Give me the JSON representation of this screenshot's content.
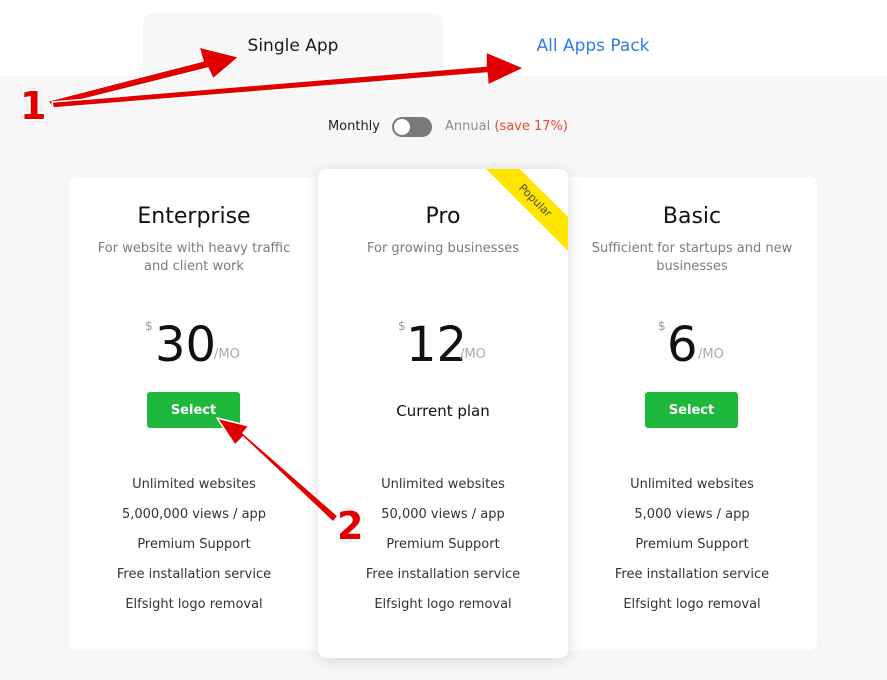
{
  "tabs": [
    {
      "label": "Single App",
      "active": true
    },
    {
      "label": "All Apps Pack",
      "active": false
    }
  ],
  "billing": {
    "monthly_label": "Monthly",
    "annual_label": "Annual",
    "save_label": "(save 17%)",
    "toggle_on": false
  },
  "plans": [
    {
      "name": "Enterprise",
      "description": "For website with heavy traffic and client work",
      "currency": "$",
      "price": "30",
      "period": "/MO",
      "action_label": "Select",
      "features": [
        "Unlimited websites",
        "5,000,000 views / app",
        "Premium Support",
        "Free installation service",
        "Elfsight logo removal"
      ]
    },
    {
      "name": "Pro",
      "description": "For growing businesses",
      "currency": "$",
      "price": "12",
      "period": "/MO",
      "badge": "Popular",
      "status_label": "Current plan",
      "features": [
        "Unlimited websites",
        "50,000 views / app",
        "Premium Support",
        "Free installation service",
        "Elfsight logo removal"
      ]
    },
    {
      "name": "Basic",
      "description": "Sufficient for startups and new businesses",
      "currency": "$",
      "price": "6",
      "period": "/MO",
      "action_label": "Select",
      "features": [
        "Unlimited websites",
        "5,000 views / app",
        "Premium Support",
        "Free installation service",
        "Elfsight logo removal"
      ]
    }
  ],
  "annotations": {
    "callout_1": "1",
    "callout_2": "2"
  },
  "colors": {
    "accent_blue": "#2f7de1",
    "select_green": "#1eb83c",
    "save_red": "#e8493a",
    "badge_yellow": "#ffe600",
    "annotation_red": "#e10000"
  }
}
